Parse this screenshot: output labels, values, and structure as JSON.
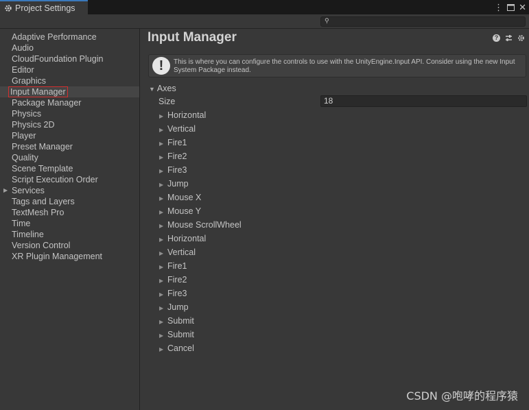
{
  "window": {
    "tab_title": "Project Settings",
    "tab_icon": "gear-icon",
    "controls": [
      "more-vert-icon",
      "maximize-icon",
      "close-icon"
    ]
  },
  "search": {
    "placeholder": "",
    "value": ""
  },
  "sidebar": {
    "selected": "Input Manager",
    "items": [
      {
        "label": "Adaptive Performance"
      },
      {
        "label": "Audio"
      },
      {
        "label": "CloudFoundation Plugin"
      },
      {
        "label": "Editor"
      },
      {
        "label": "Graphics"
      },
      {
        "label": "Input Manager"
      },
      {
        "label": "Package Manager"
      },
      {
        "label": "Physics"
      },
      {
        "label": "Physics 2D"
      },
      {
        "label": "Player"
      },
      {
        "label": "Preset Manager"
      },
      {
        "label": "Quality"
      },
      {
        "label": "Scene Template"
      },
      {
        "label": "Script Execution Order"
      },
      {
        "label": "Services"
      },
      {
        "label": "Tags and Layers"
      },
      {
        "label": "TextMesh Pro"
      },
      {
        "label": "Time"
      },
      {
        "label": "Timeline"
      },
      {
        "label": "Version Control"
      },
      {
        "label": "XR Plugin Management"
      }
    ]
  },
  "main": {
    "title": "Input Manager",
    "header_icons": [
      "help-icon",
      "preset-icon",
      "settings-icon"
    ],
    "notice": "This is where you can configure the controls to use with the UnityEngine.Input API. Consider using the new Input System Package instead.",
    "axes_label": "Axes",
    "size_label": "Size",
    "size_value": "18",
    "axes": [
      "Horizontal",
      "Vertical",
      "Fire1",
      "Fire2",
      "Fire3",
      "Jump",
      "Mouse X",
      "Mouse Y",
      "Mouse ScrollWheel",
      "Horizontal",
      "Vertical",
      "Fire1",
      "Fire2",
      "Fire3",
      "Jump",
      "Submit",
      "Submit",
      "Cancel"
    ]
  },
  "watermark": "CSDN @咆哮的程序猿"
}
